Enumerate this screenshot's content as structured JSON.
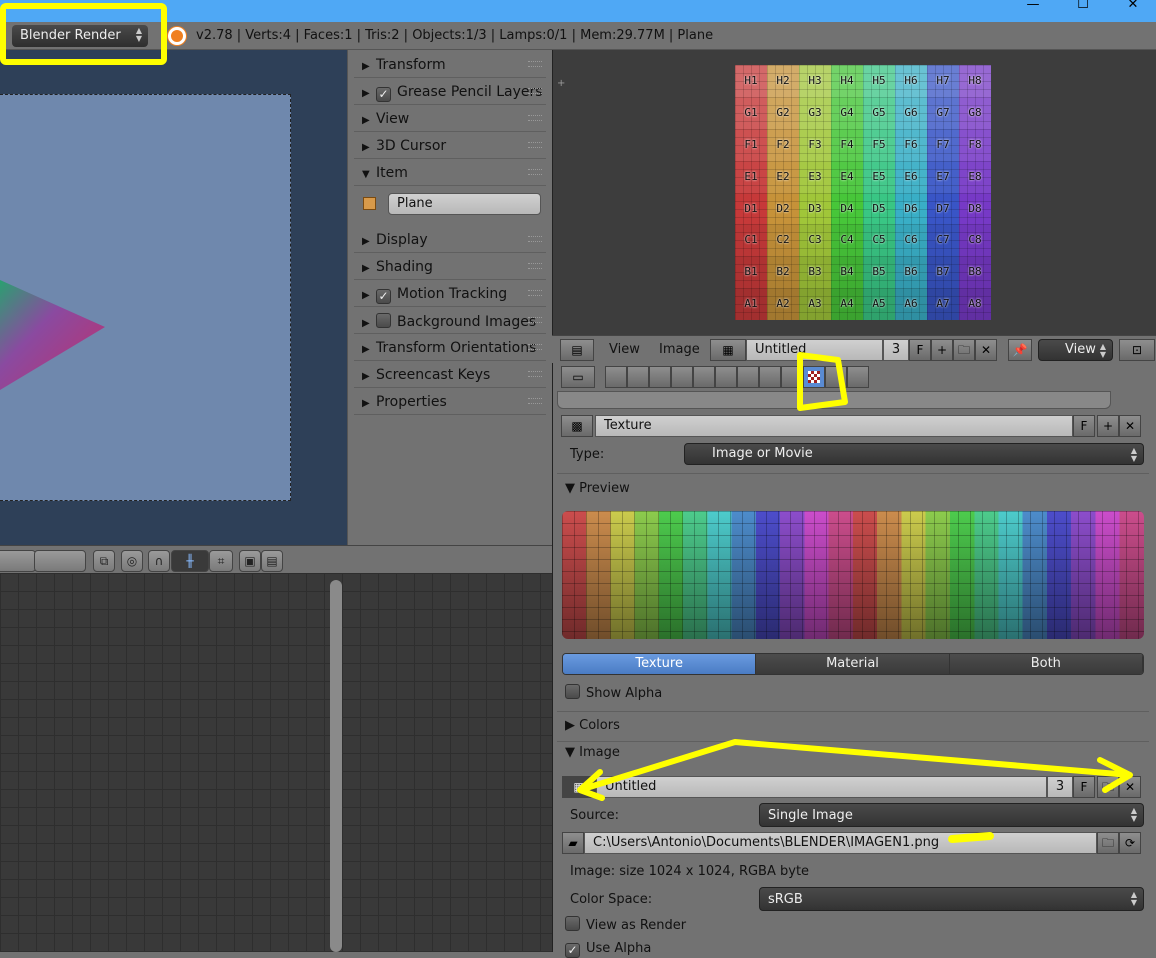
{
  "window": {
    "controls": [
      "—",
      "☐",
      "✕"
    ]
  },
  "infobar": {
    "render_engine": "Blender Render",
    "stats": "v2.78 | Verts:4 | Faces:1 | Tris:2 | Objects:1/3 | Lamps:0/1 | Mem:29.77M | Plane"
  },
  "npanel": {
    "items": [
      {
        "label": "Transform",
        "open": false
      },
      {
        "label": "Grease Pencil Layers",
        "checkbox": true
      },
      {
        "label": "View"
      },
      {
        "label": "3D Cursor"
      },
      {
        "label": "Item",
        "open": true
      },
      {
        "label": "Display"
      },
      {
        "label": "Shading"
      },
      {
        "label": "Motion Tracking",
        "checkbox": true
      },
      {
        "label": "Background Images",
        "checkbox": false
      },
      {
        "label": "Transform Orientations"
      },
      {
        "label": "Screencast Keys"
      },
      {
        "label": "Properties"
      }
    ],
    "item_name": "Plane"
  },
  "uv_image": {
    "rows": [
      "H",
      "G",
      "F",
      "E",
      "D",
      "C",
      "B",
      "A"
    ],
    "cols": [
      "1",
      "2",
      "3",
      "4",
      "5",
      "6",
      "7",
      "8"
    ]
  },
  "image_header": {
    "menus": [
      "View",
      "Image"
    ],
    "image_name": "Untitled",
    "users": "3",
    "fake": "F",
    "view_mode": "View"
  },
  "texture": {
    "name": "Texture",
    "fake": "F",
    "type_label": "Type:",
    "type": "Image or Movie",
    "preview_label": "Preview",
    "tabs": [
      "Texture",
      "Material",
      "Both"
    ],
    "active_tab": "Texture",
    "show_alpha": "Show Alpha",
    "colors_label": "Colors",
    "image_label": "Image",
    "image_name": "Untitled",
    "image_users": "3",
    "image_fake": "F",
    "source_label": "Source:",
    "source": "Single Image",
    "filepath": "C:\\Users\\Antonio\\Documents\\BLENDER\\IMAGEN1.png",
    "image_info": "Image: size 1024 x 1024, RGBA byte",
    "color_space_label": "Color Space:",
    "color_space": "sRGB",
    "view_as_render": "View as Render",
    "use_alpha": "Use Alpha"
  },
  "colors": {
    "annotation": "#ffff00",
    "accent": "#5a8bd3"
  }
}
